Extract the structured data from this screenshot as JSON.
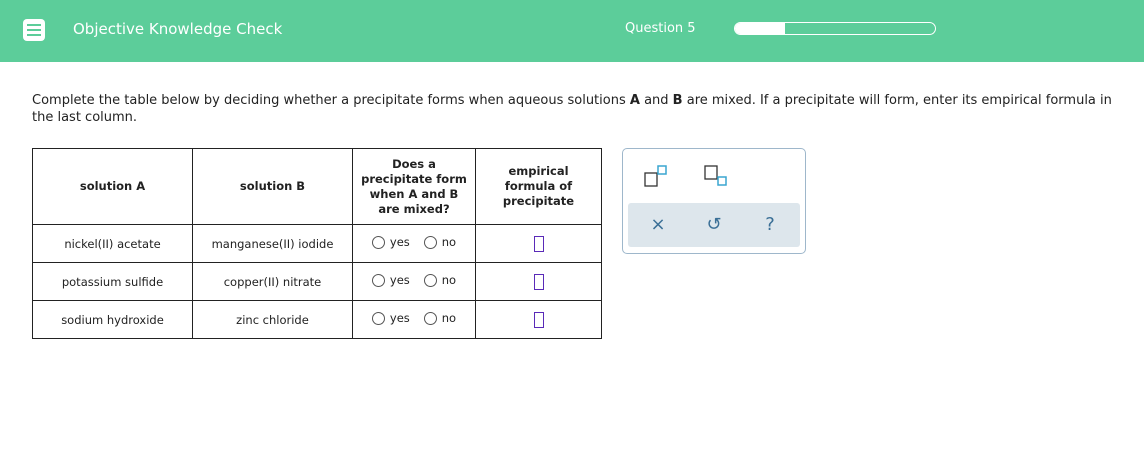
{
  "header": {
    "title": "Objective Knowledge Check",
    "question_label": "Question 5",
    "progress_fraction": 0.25,
    "colors": {
      "bar": "#5ccd9a",
      "text": "#ffffff"
    }
  },
  "instructions": {
    "part1": "Complete the table below by deciding whether a precipitate forms when aqueous solutions ",
    "bold_a": "A",
    "part2": " and ",
    "bold_b": "B",
    "part3": " are mixed. If a precipitate will form, enter its empirical formula in the last column."
  },
  "table": {
    "headers": {
      "solution_a": "solution A",
      "solution_b": "solution B",
      "precipitate_q": "Does a precipitate form when A and B are mixed?",
      "empirical": "empirical formula of precipitate"
    },
    "rows": [
      {
        "solution_a": "nickel(II) acetate",
        "solution_b": "manganese(II) iodide",
        "yes": "yes",
        "no": "no"
      },
      {
        "solution_a": "potassium sulfide",
        "solution_b": "copper(II) nitrate",
        "yes": "yes",
        "no": "no"
      },
      {
        "solution_a": "sodium hydroxide",
        "solution_b": "zinc chloride",
        "yes": "yes",
        "no": "no"
      }
    ]
  },
  "tool_panel": {
    "superscript_icon": "superscript-icon",
    "subscript_icon": "subscript-icon",
    "clear_label": "×",
    "undo_label": "↺",
    "help_label": "?",
    "accent": "#3aa6d0"
  }
}
